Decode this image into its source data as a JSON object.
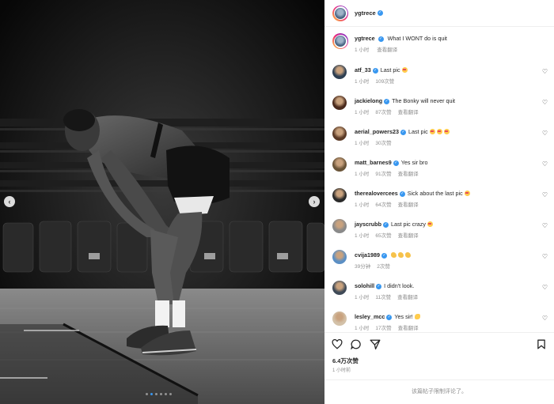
{
  "post": {
    "author": "ygtrece",
    "caption": {
      "username": "ygtrece",
      "text": "What I WONT do is quit",
      "time": "1 小时",
      "translate": "查看翻译"
    },
    "likes": "6.4万次赞",
    "time": "1 小时前",
    "comments_limited": "该篇帖子限制评论了。"
  },
  "comments": [
    {
      "username": "atf_33",
      "text": "Last pic",
      "emoji": "heart-eyes",
      "time": "1 小时",
      "likes": "109次赞",
      "translate": "",
      "avatar_color": "#2e3f52"
    },
    {
      "username": "jackielong",
      "text": "The Bonky will never quit",
      "emoji": "",
      "time": "1 小时",
      "likes": "87次赞",
      "translate": "查看翻译",
      "avatar_color": "#4a2a1c"
    },
    {
      "username": "aerial_powers23",
      "text": "Last pic",
      "emoji": "heart-eyes-3",
      "time": "1 小时",
      "likes": "30次赞",
      "translate": "",
      "avatar_color": "#5b3a26"
    },
    {
      "username": "matt_barnes9",
      "text": "Yes sir bro",
      "emoji": "",
      "time": "1 小时",
      "likes": "91次赞",
      "translate": "查看翻译",
      "avatar_color": "#6a5438"
    },
    {
      "username": "therealovercees",
      "text": "Sick about the last pic",
      "emoji": "heart-eyes",
      "time": "1 小时",
      "likes": "64次赞",
      "translate": "查看翻译",
      "avatar_color": "#2a2a2a"
    },
    {
      "username": "jayscrubb",
      "text": "Last pic crazy",
      "emoji": "heart-eyes",
      "time": "1 小时",
      "likes": "65次赞",
      "translate": "查看翻译",
      "avatar_color": "#8a8a8a"
    },
    {
      "username": "cvija1989",
      "text": "",
      "emoji": "flex-3",
      "time": "39分钟",
      "likes": "2次赞",
      "translate": "",
      "avatar_color": "#5b8fc4"
    },
    {
      "username": "solohill",
      "text": "I didn't look.",
      "emoji": "",
      "time": "1 小时",
      "likes": "11次赞",
      "translate": "查看翻译",
      "avatar_color": "#3f4a57"
    },
    {
      "username": "lesley_mcc",
      "text": "Yes sir!",
      "emoji": "clap",
      "time": "1 小时",
      "likes": "17次赞",
      "translate": "查看翻译",
      "avatar_color": "#d3c1a8"
    }
  ],
  "icons": {
    "like": "heart-outline-icon",
    "comment": "comment-bubble-icon",
    "share": "paper-plane-icon",
    "save": "bookmark-icon",
    "verified": "verified-badge-icon",
    "prev": "chevron-left-icon",
    "next": "chevron-right-icon"
  },
  "colors": {
    "verified": "#3897f0",
    "muted": "#8e8e8e",
    "text": "#262626"
  }
}
